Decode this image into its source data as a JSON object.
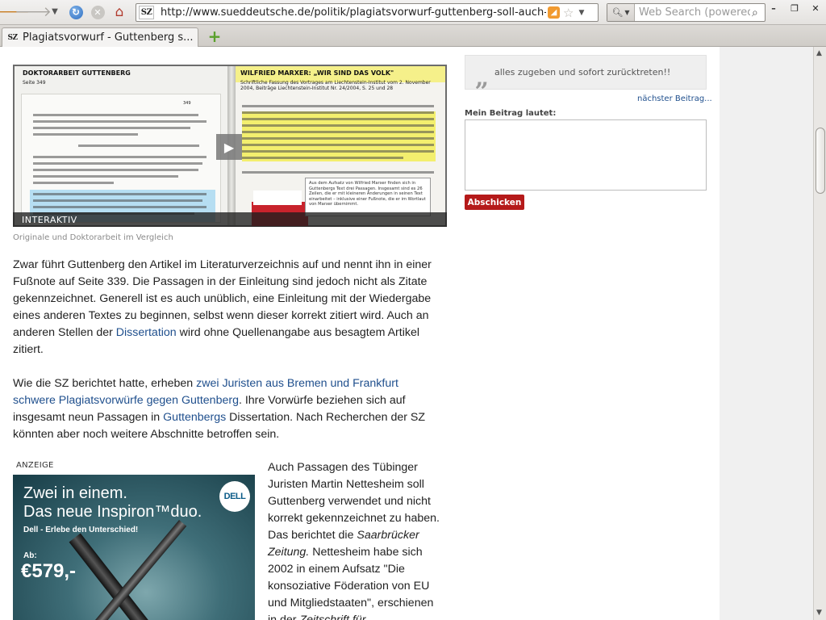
{
  "browser": {
    "url": "http://www.sueddeutsche.de/politik/plagiatsvorwurf-guttenberg-soll-auch-i",
    "favicon_text": "SZ",
    "search_placeholder": "Web Search (powered",
    "tab_title": "Plagiatsvorwurf - Guttenberg s...",
    "icons": [
      "back-arrow-icon",
      "forward-arrow-icon",
      "history-dropdown-icon",
      "reload-icon",
      "stop-icon",
      "home-icon",
      "rss-icon",
      "bookmark-star-icon",
      "search-icon",
      "new-tab-icon"
    ]
  },
  "figure": {
    "left_header": "DOKTORARBEIT GUTTENBERG",
    "left_sub": "Seite 349",
    "left_page_number": "349",
    "right_header": "WILFRIED MARXER: „WIR SIND DAS VOLK\"",
    "right_sub": "Schriftliche Fassung des Vortrages am Liechtenstein-Institut vom 2. November 2004, Beiträge Liechtenstein-Institut Nr. 24/2004,  S. 25 und 28",
    "tooltip": "Aus dem Aufsatz von Wilfried Marxer finden sich in Guttenbergs Text drei Passagen. Insgesamt sind es 26 Zeilen, die er mit kleineren Änderungen in seinen Text einarbeitet – inklusive einer Fußnote, die er im Wortlaut von Marxer übernimmt.",
    "label": "INTERAKTIV",
    "caption": "Originale und Doktorarbeit im Vergleich"
  },
  "article": {
    "p1": {
      "before": "Zwar führt Guttenberg den Artikel im Literaturverzeichnis auf und nennt ihn in einer Fußnote auf Seite 339. Die Passagen in der Einleitung sind jedoch nicht als Zitate gekennzeichnet. Generell ist es auch unüblich, eine Einleitung mit der Wiedergabe eines anderen Textes zu beginnen, selbst wenn dieser korrekt zitiert wird. Auch an anderen Stellen der ",
      "link": "Dissertation",
      "after": " wird ohne Quellenangabe aus besagtem Artikel zitiert."
    },
    "p2": {
      "before": "Wie die SZ berichtet hatte, erheben ",
      "link1": "zwei Juristen aus Bremen und Frankfurt schwere Plagiatsvorwürfe gegen Guttenberg",
      "mid": ". Ihre Vorwürfe beziehen sich auf insgesamt neun Passagen in ",
      "link2": "Guttenbergs",
      "after": " Dissertation. Nach Recherchen der SZ könnten aber noch weitere Abschnitte betroffen sein."
    },
    "p3": {
      "before": "Auch Passagen des Tübinger Juristen Martin Nettesheim soll Guttenberg verwendet und nicht korrekt gekennzeichnet zu haben. Das berichtet die ",
      "italic1": "Saarbrücker Zeitung.",
      "mid": " Nettesheim habe sich 2002 in einem Aufsatz \"Die konsoziative Föderation von EU und Mitgliedstaaten\", erschienen in der ",
      "italic2": "Zeitschrift für",
      "after": ""
    }
  },
  "ad": {
    "label": "ANZEIGE",
    "headline1": "Zwei in einem.",
    "headline2": "Das neue Inspiron™duo.",
    "tagline": "Dell - Erlebe den Unterschied!",
    "from": "Ab:",
    "price": "€579,-",
    "logo": "DELL"
  },
  "sidebar": {
    "quote": "alles zugeben und sofort zurücktreten!!",
    "next_link": "nächster Beitrag...",
    "form_label": "Mein Beitrag lautet:",
    "submit": "Abschicken"
  }
}
